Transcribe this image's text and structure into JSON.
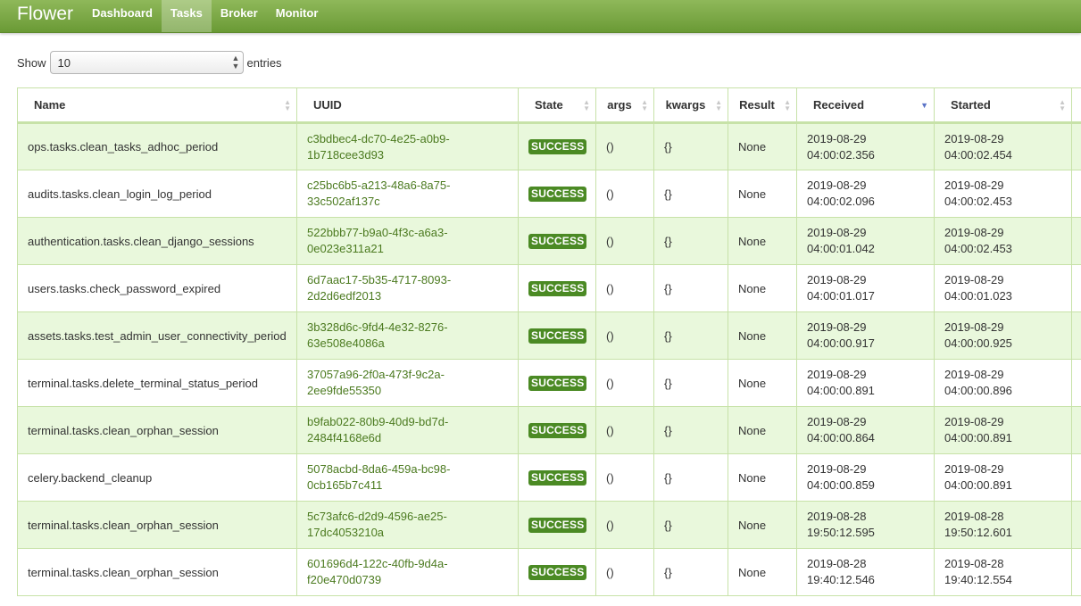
{
  "navbar": {
    "brand": "Flower",
    "items": [
      {
        "label": "Dashboard",
        "active": false
      },
      {
        "label": "Tasks",
        "active": true
      },
      {
        "label": "Broker",
        "active": false
      },
      {
        "label": "Monitor",
        "active": false
      }
    ]
  },
  "length": {
    "prefix": "Show",
    "value": "10",
    "suffix": "entries"
  },
  "table": {
    "columns": [
      "Name",
      "UUID",
      "State",
      "args",
      "kwargs",
      "Result",
      "Received",
      "Started"
    ],
    "sorted_column": "Received",
    "rows": [
      {
        "name": "ops.tasks.clean_tasks_adhoc_period",
        "uuid1": "c3bdbec4-dc70-4e25-a0b9-",
        "uuid2": "1b718cee3d93",
        "state": "SUCCESS",
        "args": "()",
        "kwargs": "{}",
        "result": "None",
        "received1": "2019-08-29",
        "received2": "04:00:02.356",
        "started1": "2019-08-29",
        "started2": "04:00:02.454"
      },
      {
        "name": "audits.tasks.clean_login_log_period",
        "uuid1": "c25bc6b5-a213-48a6-8a75-",
        "uuid2": "33c502af137c",
        "state": "SUCCESS",
        "args": "()",
        "kwargs": "{}",
        "result": "None",
        "received1": "2019-08-29",
        "received2": "04:00:02.096",
        "started1": "2019-08-29",
        "started2": "04:00:02.453"
      },
      {
        "name": "authentication.tasks.clean_django_sessions",
        "uuid1": "522bbb77-b9a0-4f3c-a6a3-",
        "uuid2": "0e023e311a21",
        "state": "SUCCESS",
        "args": "()",
        "kwargs": "{}",
        "result": "None",
        "received1": "2019-08-29",
        "received2": "04:00:01.042",
        "started1": "2019-08-29",
        "started2": "04:00:02.453"
      },
      {
        "name": "users.tasks.check_password_expired",
        "uuid1": "6d7aac17-5b35-4717-8093-",
        "uuid2": "2d2d6edf2013",
        "state": "SUCCESS",
        "args": "()",
        "kwargs": "{}",
        "result": "None",
        "received1": "2019-08-29",
        "received2": "04:00:01.017",
        "started1": "2019-08-29",
        "started2": "04:00:01.023"
      },
      {
        "name": "assets.tasks.test_admin_user_connectivity_period",
        "uuid1": "3b328d6c-9fd4-4e32-8276-",
        "uuid2": "63e508e4086a",
        "state": "SUCCESS",
        "args": "()",
        "kwargs": "{}",
        "result": "None",
        "received1": "2019-08-29",
        "received2": "04:00:00.917",
        "started1": "2019-08-29",
        "started2": "04:00:00.925"
      },
      {
        "name": "terminal.tasks.delete_terminal_status_period",
        "uuid1": "37057a96-2f0a-473f-9c2a-",
        "uuid2": "2ee9fde55350",
        "state": "SUCCESS",
        "args": "()",
        "kwargs": "{}",
        "result": "None",
        "received1": "2019-08-29",
        "received2": "04:00:00.891",
        "started1": "2019-08-29",
        "started2": "04:00:00.896"
      },
      {
        "name": "terminal.tasks.clean_orphan_session",
        "uuid1": "b9fab022-80b9-40d9-bd7d-",
        "uuid2": "2484f4168e6d",
        "state": "SUCCESS",
        "args": "()",
        "kwargs": "{}",
        "result": "None",
        "received1": "2019-08-29",
        "received2": "04:00:00.864",
        "started1": "2019-08-29",
        "started2": "04:00:00.891"
      },
      {
        "name": "celery.backend_cleanup",
        "uuid1": "5078acbd-8da6-459a-bc98-",
        "uuid2": "0cb165b7c411",
        "state": "SUCCESS",
        "args": "()",
        "kwargs": "{}",
        "result": "None",
        "received1": "2019-08-29",
        "received2": "04:00:00.859",
        "started1": "2019-08-29",
        "started2": "04:00:00.891"
      },
      {
        "name": "terminal.tasks.clean_orphan_session",
        "uuid1": "5c73afc6-d2d9-4596-ae25-",
        "uuid2": "17dc4053210a",
        "state": "SUCCESS",
        "args": "()",
        "kwargs": "{}",
        "result": "None",
        "received1": "2019-08-28",
        "received2": "19:50:12.595",
        "started1": "2019-08-28",
        "started2": "19:50:12.601"
      },
      {
        "name": "terminal.tasks.clean_orphan_session",
        "uuid1": "601696d4-122c-40fb-9d4a-",
        "uuid2": "f20e470d0739",
        "state": "SUCCESS",
        "args": "()",
        "kwargs": "{}",
        "result": "None",
        "received1": "2019-08-28",
        "received2": "19:40:12.546",
        "started1": "2019-08-28",
        "started2": "19:40:12.554"
      }
    ]
  }
}
